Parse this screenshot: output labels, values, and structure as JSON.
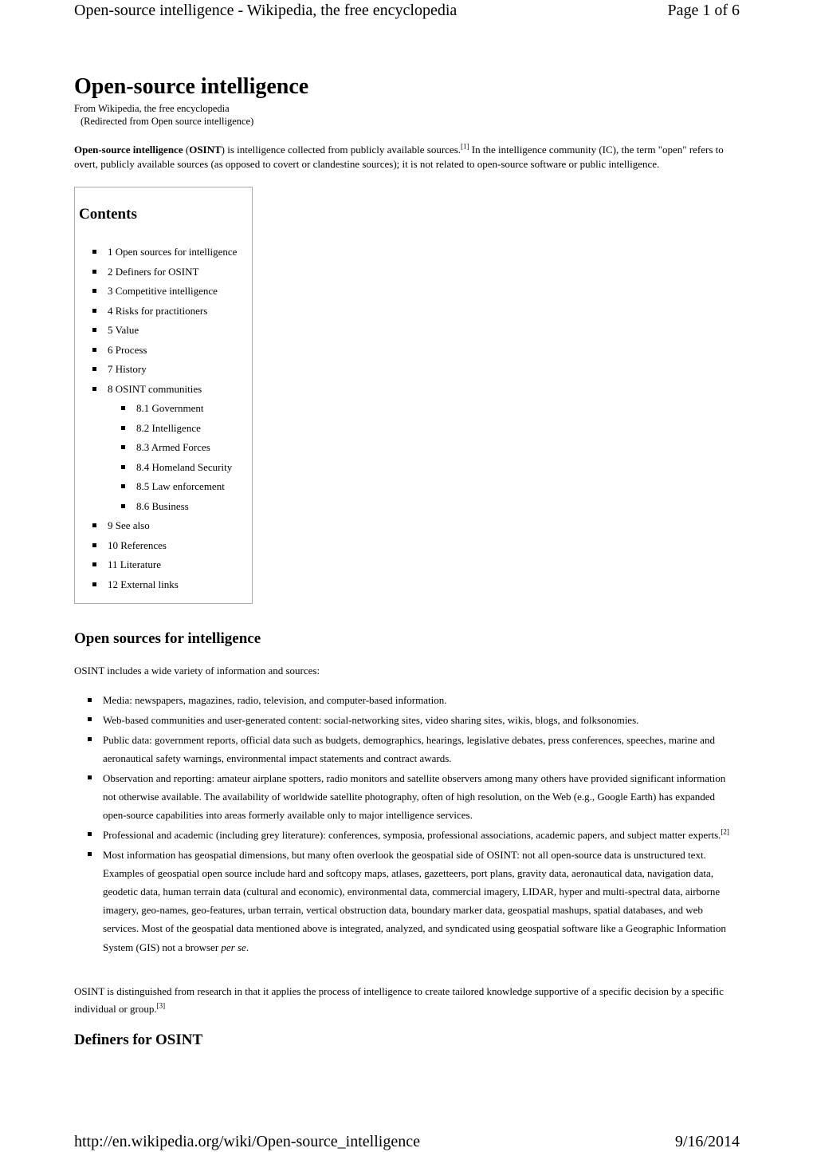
{
  "print_header": {
    "title": "Open-source intelligence - Wikipedia, the free encyclopedia",
    "page_indicator": "Page 1 of 6"
  },
  "print_footer": {
    "url": "http://en.wikipedia.org/wiki/Open-source_intelligence",
    "date": "9/16/2014"
  },
  "article": {
    "title": "Open-source intelligence",
    "site_sub": "From Wikipedia, the free encyclopedia",
    "redirect_note": "(Redirected from Open source intelligence)",
    "lead": {
      "bold_term": "Open-source intelligence",
      "open_paren": " (",
      "abbr": "OSINT",
      "text_1": ") is intelligence collected from publicly available sources.",
      "ref_1": "[1]",
      "text_2": " In the intelligence community (IC), the term \"open\" refers to overt, publicly available sources (as opposed to covert or clandestine sources); it is not related to open-source software or public intelligence."
    }
  },
  "toc": {
    "title": "Contents",
    "items": [
      {
        "label": "1 Open sources for intelligence",
        "level": 1
      },
      {
        "label": "2 Definers for OSINT",
        "level": 1
      },
      {
        "label": "3 Competitive intelligence",
        "level": 1
      },
      {
        "label": "4 Risks for practitioners",
        "level": 1
      },
      {
        "label": "5 Value",
        "level": 1
      },
      {
        "label": "6 Process",
        "level": 1
      },
      {
        "label": "7 History",
        "level": 1
      },
      {
        "label": "8 OSINT communities",
        "level": 1
      },
      {
        "label": "8.1 Government",
        "level": 2
      },
      {
        "label": "8.2 Intelligence",
        "level": 2
      },
      {
        "label": "8.3 Armed Forces",
        "level": 2
      },
      {
        "label": "8.4 Homeland Security",
        "level": 2
      },
      {
        "label": "8.5 Law enforcement",
        "level": 2
      },
      {
        "label": "8.6 Business",
        "level": 2
      },
      {
        "label": "9 See also",
        "level": 1
      },
      {
        "label": "10 References",
        "level": 1
      },
      {
        "label": "11 Literature",
        "level": 1
      },
      {
        "label": "12 External links",
        "level": 1
      }
    ]
  },
  "section_open_sources": {
    "heading": "Open sources for intelligence",
    "intro": "OSINT includes a wide variety of information and sources:",
    "items": [
      {
        "text": "Media: newspapers, magazines, radio, television, and computer-based information."
      },
      {
        "text": "Web-based communities and user-generated content: social-networking sites, video sharing sites, wikis, blogs, and folksonomies."
      },
      {
        "text": "Public data: government reports, official data such as budgets, demographics, hearings, legislative debates, press conferences, speeches, marine and aeronautical safety warnings, environmental impact statements and contract awards."
      },
      {
        "text": "Observation and reporting: amateur airplane spotters, radio monitors and satellite observers among many others have provided significant information not otherwise available. The availability of worldwide satellite photography, often of high resolution, on the Web (e.g., Google Earth) has expanded open-source capabilities into areas formerly available only to major intelligence services."
      },
      {
        "text": "Professional and academic (including grey literature): conferences, symposia, professional associations, academic papers, and subject matter experts.",
        "ref": "[2]"
      },
      {
        "text": "Most information has geospatial dimensions, but many often overlook the geospatial side of OSINT: not all open-source data is unstructured text. Examples of geospatial open source include hard and softcopy maps, atlases, gazetteers, port plans, gravity data, aeronautical data, navigation data, geodetic data, human terrain data (cultural and economic), environmental data, commercial imagery, LIDAR, hyper and multi-spectral data, airborne imagery, geo-names, geo-features, urban terrain, vertical obstruction data, boundary marker data, geospatial mashups, spatial databases, and web services. Most of the geospatial data mentioned above is integrated, analyzed, and syndicated using geospatial software like a Geographic Information System (GIS) not a browser ",
        "italic_tail": "per se",
        "end": "."
      }
    ],
    "closing_paragraph": "OSINT is distinguished from research in that it applies the process of intelligence to create tailored knowledge supportive of a specific decision by a specific individual or group.",
    "closing_ref": "[3]"
  },
  "section_definers": {
    "heading": "Definers for OSINT"
  }
}
